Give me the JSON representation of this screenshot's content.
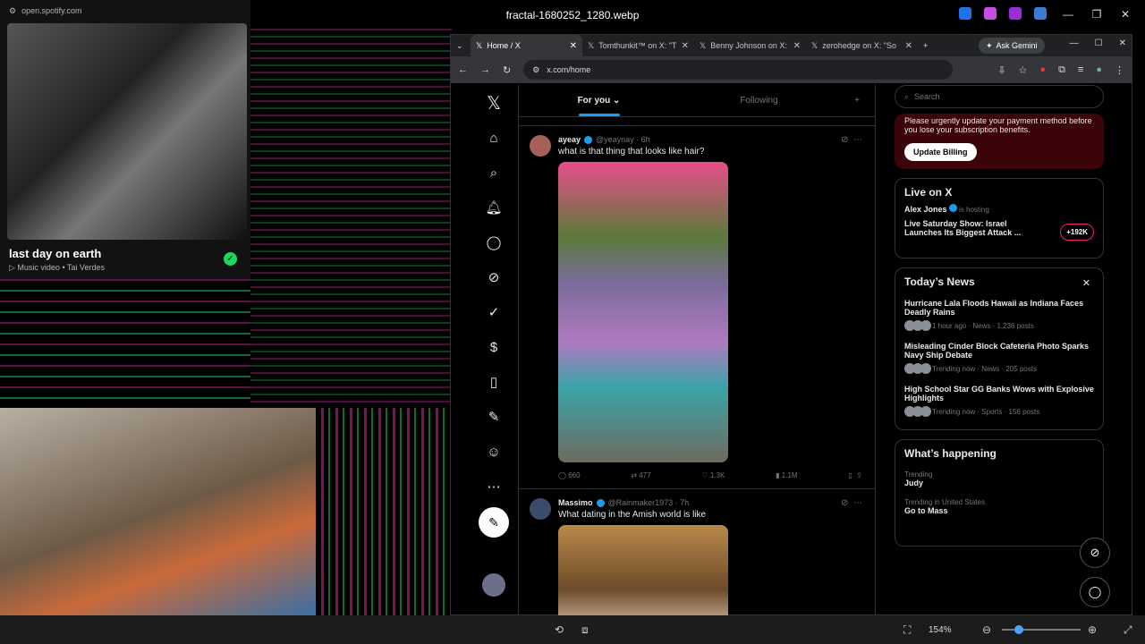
{
  "viewer": {
    "title": "fractal-1680252_1280.webp",
    "zoom": "154%"
  },
  "spotify": {
    "url": "open.spotify.com",
    "song_title": "last day on earth",
    "subtitle": "Music video • Tai Verdes"
  },
  "browser": {
    "tabs": [
      {
        "label": "Home / X",
        "active": true
      },
      {
        "label": "Tomthunkit™ on X: \"T",
        "active": false
      },
      {
        "label": "Benny Johnson on X:",
        "active": false
      },
      {
        "label": "zerohedge on X: \"So",
        "active": false
      }
    ],
    "gemini_label": "Ask Gemini",
    "url": "x.com/home"
  },
  "x": {
    "feed_tabs": {
      "for_you": "For you",
      "following": "Following"
    },
    "posts": [
      {
        "name": "ayeay",
        "handle": "@yeaynay · 6h",
        "text": "what is that thing that looks like hair?",
        "replies": "660",
        "reposts": "477",
        "likes": "1.3K",
        "views": "1.1M"
      },
      {
        "name": "Massimo",
        "handle": "@Rainmaker1973 · 7h",
        "text": "What dating in the Amish world is like"
      }
    ],
    "right": {
      "search_placeholder": "Search",
      "billing_text": "Please urgently update your payment method before you lose your subscription benefits.",
      "billing_button": "Update Billing",
      "live": {
        "title": "Live on X",
        "host": "Alex Jones",
        "host_suffix": "is hosting",
        "show": "Live Saturday Show: Israel Launches Its Biggest Attack ...",
        "badge": "+192K"
      },
      "news": {
        "title": "Today’s News",
        "items": [
          {
            "headline": "Hurricane Lala Floods Hawaii as Indiana Faces Deadly Rains",
            "meta": "1 hour ago · News · 1,236 posts"
          },
          {
            "headline": "Misleading Cinder Block Cafeteria Photo Sparks Navy Ship Debate",
            "meta": "Trending now · News · 205 posts"
          },
          {
            "headline": "High School Star GG Banks Wows with Explosive Highlights",
            "meta": "Trending now · Sports · 156 posts"
          }
        ]
      },
      "happening": {
        "title": "What’s happening",
        "items": [
          {
            "context": "Trending",
            "topic": "Judy"
          },
          {
            "context": "Trending in United States",
            "topic": "Go to Mass"
          }
        ]
      }
    }
  }
}
